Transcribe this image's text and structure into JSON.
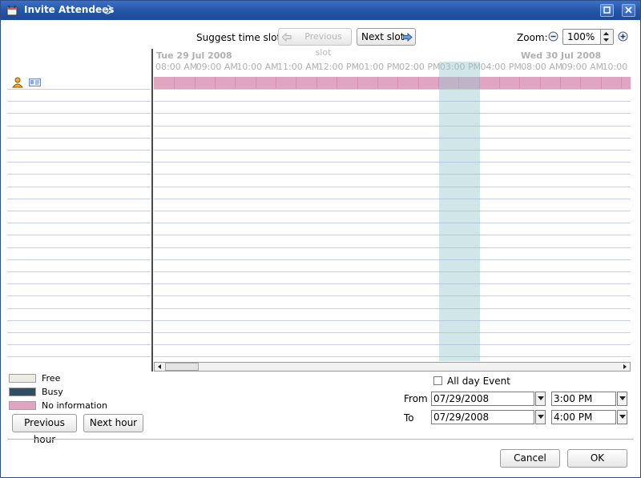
{
  "window": {
    "title": "Invite Attendees"
  },
  "toolbar": {
    "suggest_label": "Suggest time slot:",
    "previous_slot": "Previous slot",
    "next_slot": "Next slot",
    "zoom_label": "Zoom:",
    "zoom_value": "100%"
  },
  "timeline": {
    "date1": "Tue 29 Jul 2008",
    "date2": "Wed 30 Jul 2008",
    "hours": [
      "08:00 AM",
      "09:00 AM",
      "10:00 AM",
      "11:00 AM",
      "12:00 PM",
      "01:00 PM",
      "02:00 PM",
      "03:00 PM",
      "04:00 PM",
      "08:00 AM",
      "09:00 AM",
      "10:00 AM"
    ]
  },
  "legend": {
    "free": "Free",
    "busy": "Busy",
    "no_info": "No information",
    "colors": {
      "free": "#ecece4",
      "busy": "#2f4e63",
      "no_info": "#e0a5c3"
    }
  },
  "nav": {
    "previous_hour": "Previous hour",
    "next_hour": "Next hour"
  },
  "event": {
    "all_day_label": "All day Event",
    "from_label": "From",
    "to_label": "To",
    "from_date": "07/29/2008",
    "from_time": "3:00 PM",
    "to_date": "07/29/2008",
    "to_time": "4:00 PM"
  },
  "dialog": {
    "cancel": "Cancel",
    "ok": "OK"
  }
}
